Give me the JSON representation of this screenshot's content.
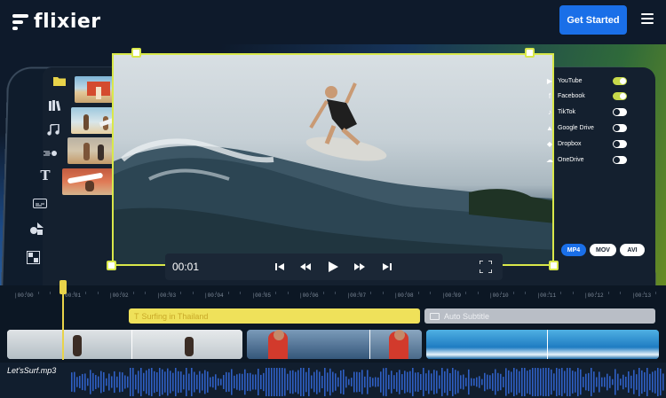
{
  "header": {
    "brand": "flixier",
    "cta_label": "Get Started",
    "menu_icon": "hamburger-icon"
  },
  "sidebar_tools": [
    {
      "name": "folder-icon",
      "active": true
    },
    {
      "name": "library-icon",
      "active": false
    },
    {
      "name": "music-icon",
      "active": false
    },
    {
      "name": "transition-icon",
      "active": false
    },
    {
      "name": "text-icon",
      "active": false
    },
    {
      "name": "subtitle-icon",
      "active": false
    },
    {
      "name": "shapes-icon",
      "active": false
    },
    {
      "name": "overlay-icon",
      "active": false
    }
  ],
  "player": {
    "time": "00:01"
  },
  "export": {
    "destinations": [
      {
        "label": "YouTube",
        "icon": "youtube-icon",
        "enabled": true
      },
      {
        "label": "Facebook",
        "icon": "facebook-icon",
        "enabled": true
      },
      {
        "label": "TikTok",
        "icon": "tiktok-icon",
        "enabled": false
      },
      {
        "label": "Google Drive",
        "icon": "google-drive-icon",
        "enabled": false
      },
      {
        "label": "Dropbox",
        "icon": "dropbox-icon",
        "enabled": false
      },
      {
        "label": "OneDrive",
        "icon": "onedrive-icon",
        "enabled": false
      }
    ],
    "formats": [
      {
        "label": "MP4",
        "selected": true
      },
      {
        "label": "MOV",
        "selected": false
      },
      {
        "label": "AVI",
        "selected": false
      }
    ]
  },
  "timeline": {
    "ruler": [
      "|00:00",
      "|00:01",
      "|00:02",
      "|00:03",
      "|00:04",
      "|00:05",
      "|00:06",
      "|00:07",
      "|00:08",
      "|00:09",
      "|00:10",
      "|00:11",
      "|00:12",
      "|00:13"
    ],
    "text_clip": "Surfing in Thailand",
    "subtitle_clip": "Auto Subtitle",
    "audio_track": "Let'sSurf.mp3"
  },
  "colors": {
    "accent": "#d9e84a",
    "cta": "#1a6fe8",
    "background": "#0e1a2b",
    "audio_wave": "#2f5fc4"
  }
}
